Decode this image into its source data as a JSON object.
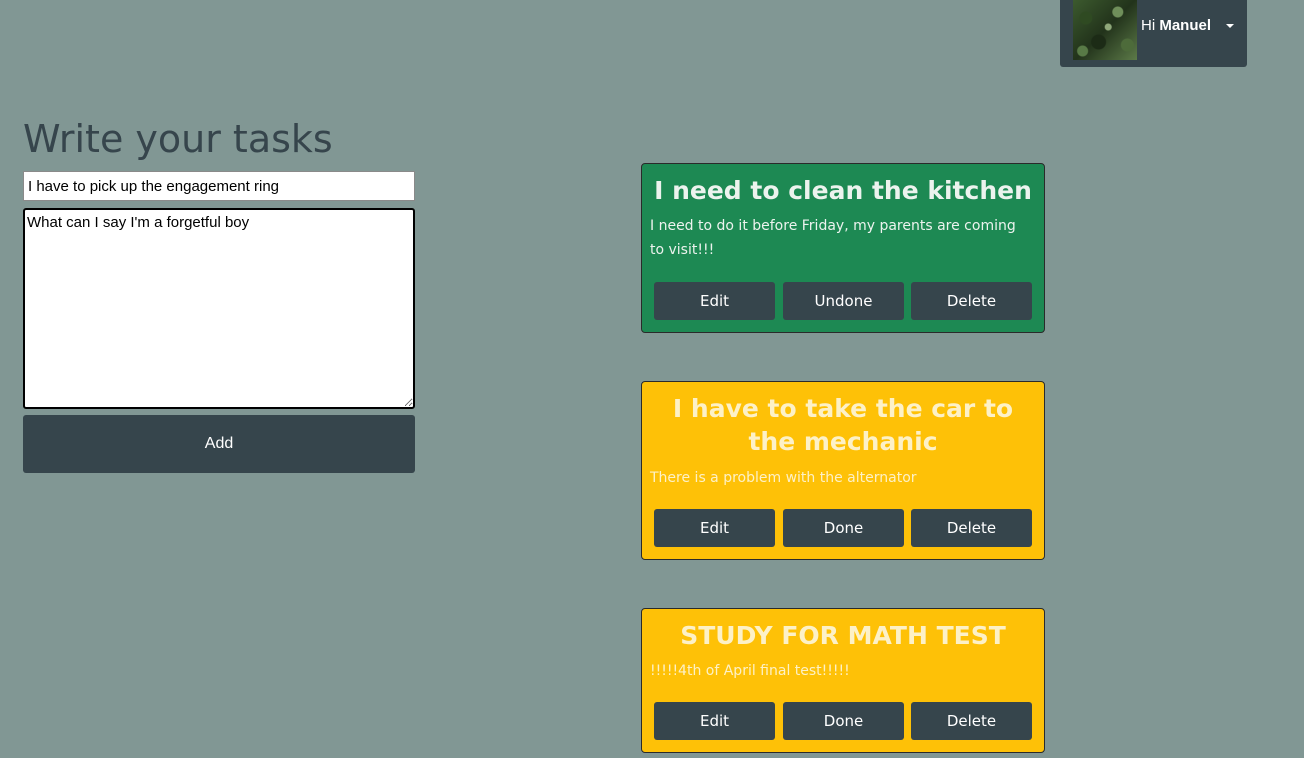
{
  "user_menu": {
    "greeting": "Hi",
    "username": "Manuel"
  },
  "form": {
    "heading": "Write your tasks",
    "title_value": "I have to pick up the engagement ring",
    "description_value": "What can I say I'm a forgetful boy",
    "add_label": "Add"
  },
  "tasks": [
    {
      "title": "I need to clean the kitchen",
      "description": "I need to do it before Friday, my parents are coming to visit!!!",
      "status": "done",
      "color": "#1d8953",
      "edit_label": "Edit",
      "toggle_label": "Undone",
      "delete_label": "Delete"
    },
    {
      "title": "I have to take the car to the mechanic",
      "description": "There is a problem with the alternator",
      "status": "pending",
      "color": "#fec107",
      "edit_label": "Edit",
      "toggle_label": "Done",
      "delete_label": "Delete"
    },
    {
      "title": "STUDY FOR MATH TEST",
      "description": "!!!!!4th of April final test!!!!!",
      "status": "pending",
      "color": "#fec107",
      "edit_label": "Edit",
      "toggle_label": "Done",
      "delete_label": "Delete"
    }
  ],
  "colors": {
    "background": "#819794",
    "dark": "#36454c",
    "done": "#1d8953",
    "pending": "#fec107"
  }
}
